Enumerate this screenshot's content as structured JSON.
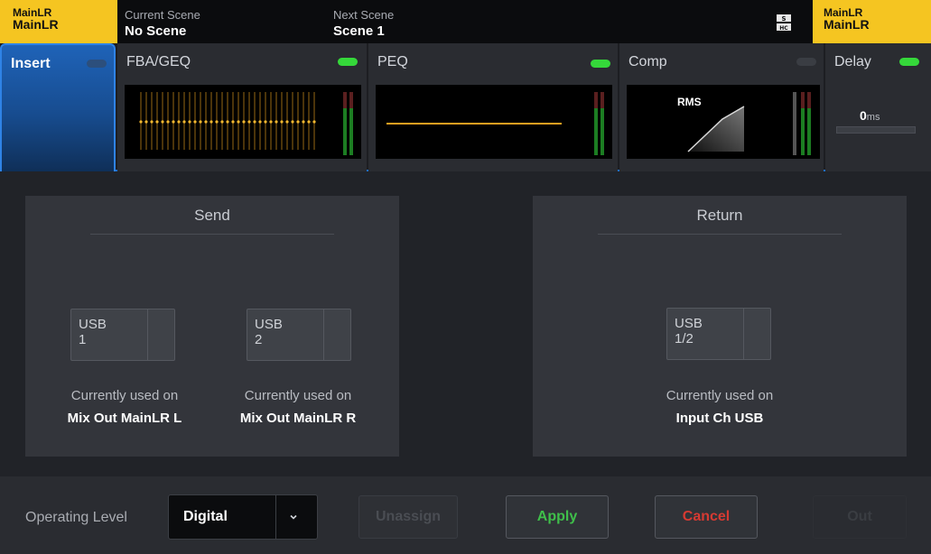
{
  "topbar": {
    "left_channel": {
      "line1": "MainLR",
      "line2": "MainLR"
    },
    "current_scene": {
      "label": "Current Scene",
      "value": "No Scene"
    },
    "next_scene": {
      "label": "Next Scene",
      "value": "Scene 1"
    },
    "right_channel": {
      "line1": "MainLR",
      "line2": "MainLR"
    },
    "sd_icon": "sd-card-icon"
  },
  "tabs": [
    {
      "label": "Insert",
      "active": true,
      "led_on": false
    },
    {
      "label": "FBA/GEQ",
      "active": false,
      "led_on": true
    },
    {
      "label": "PEQ",
      "active": false,
      "led_on": true
    },
    {
      "label": "Comp",
      "active": false,
      "led_on": false,
      "detector": "RMS"
    },
    {
      "label": "Delay",
      "active": false,
      "led_on": true,
      "value": "0",
      "unit": "ms"
    }
  ],
  "send": {
    "title": "Send",
    "ports": [
      {
        "label": "USB\n1",
        "used_label": "Currently used on",
        "used_value": "Mix Out MainLR L"
      },
      {
        "label": "USB\n2",
        "used_label": "Currently used on",
        "used_value": "Mix Out MainLR R"
      }
    ]
  },
  "return": {
    "title": "Return",
    "ports": [
      {
        "label": "USB\n1/2",
        "used_label": "Currently used on",
        "used_value": "Input Ch USB"
      }
    ]
  },
  "bottom": {
    "operating_level_label": "Operating Level",
    "operating_level_value": "Digital",
    "unassign": "Unassign",
    "apply": "Apply",
    "cancel": "Cancel",
    "out": "Out"
  },
  "colors": {
    "accent_blue": "#1f6fd1",
    "badge_yellow": "#f5c521",
    "led_green": "#35d83a",
    "apply_green": "#3fbf4a",
    "cancel_red": "#d63a32",
    "trace_orange": "#f0a020"
  }
}
